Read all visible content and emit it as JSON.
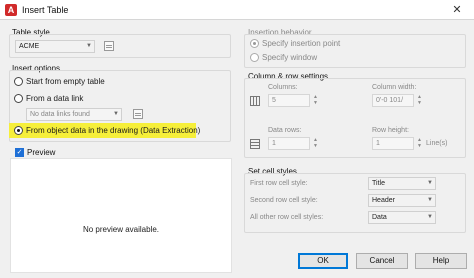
{
  "window": {
    "title": "Insert Table",
    "close_icon": "✕"
  },
  "table_style": {
    "label": "Table style",
    "value": "ACME"
  },
  "insert_options": {
    "label": "Insert options",
    "empty_table": "Start from empty table",
    "data_link": "From a data link",
    "data_link_value": "No data links found",
    "object_data": "From object data in the drawing (Data Extraction)"
  },
  "preview": {
    "label": "Preview",
    "checked": true,
    "text": "No preview available."
  },
  "insertion": {
    "label": "Insertion behavior",
    "point": "Specify insertion point",
    "window": "Specify window"
  },
  "column_row": {
    "label": "Column & row settings",
    "columns_label": "Columns:",
    "columns_value": "5",
    "width_label": "Column width:",
    "width_value": "0'-0 101/",
    "rows_label": "Data rows:",
    "rows_value": "1",
    "height_label": "Row height:",
    "height_value": "1",
    "lines_unit": "Line(s)"
  },
  "cell_styles": {
    "label": "Set cell styles",
    "first_label": "First row cell style:",
    "first_value": "Title",
    "second_label": "Second row cell style:",
    "second_value": "Header",
    "other_label": "All other row cell styles:",
    "other_value": "Data"
  },
  "buttons": {
    "ok": "OK",
    "cancel": "Cancel",
    "help": "Help"
  },
  "colors": {
    "highlight": "#f6ef3a",
    "accent": "#0078d7"
  }
}
